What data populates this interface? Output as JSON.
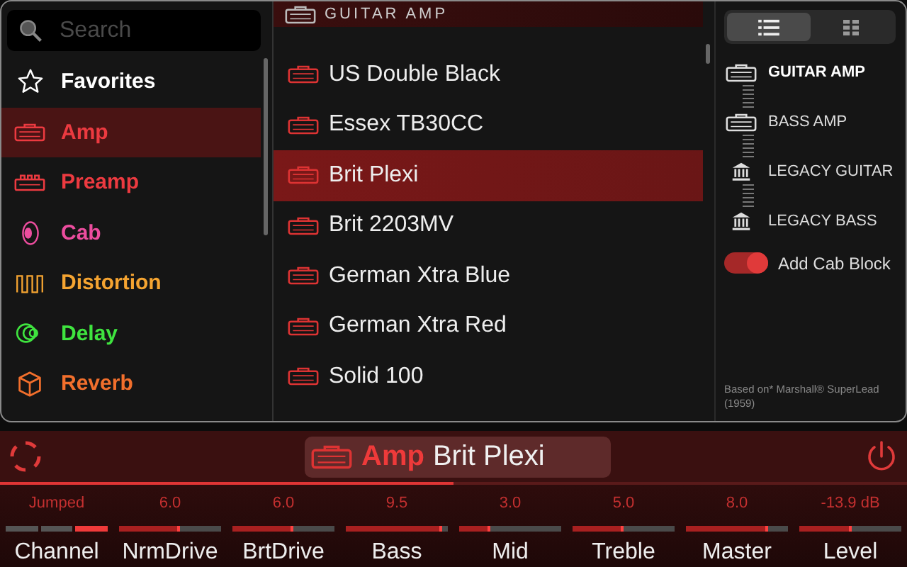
{
  "search": {
    "placeholder": "Search"
  },
  "categories": [
    {
      "label": "Favorites",
      "kind": "favorites",
      "color": "#ffffff",
      "selected": false
    },
    {
      "label": "Amp",
      "kind": "amp",
      "color": "#ec3a40",
      "selected": true
    },
    {
      "label": "Preamp",
      "kind": "preamp",
      "color": "#ec3a40",
      "selected": false
    },
    {
      "label": "Cab",
      "kind": "cab",
      "color": "#ec4d9e",
      "selected": false
    },
    {
      "label": "Distortion",
      "kind": "distortion",
      "color": "#f5a431",
      "selected": false
    },
    {
      "label": "Delay",
      "kind": "delay",
      "color": "#3fe43f",
      "selected": false
    },
    {
      "label": "Reverb",
      "kind": "reverb",
      "color": "#f26f2c",
      "selected": false
    }
  ],
  "model_list": {
    "header": "GUITAR AMP",
    "items": [
      {
        "label": "US Double Black",
        "selected": false
      },
      {
        "label": "Essex TB30CC",
        "selected": false
      },
      {
        "label": "Brit Plexi",
        "selected": true
      },
      {
        "label": "Brit 2203MV",
        "selected": false
      },
      {
        "label": "German Xtra Blue",
        "selected": false
      },
      {
        "label": "German Xtra Red",
        "selected": false
      },
      {
        "label": "Solid 100",
        "selected": false
      }
    ]
  },
  "view_toggle": [
    {
      "kind": "list",
      "selected": true
    },
    {
      "kind": "grid",
      "selected": false
    }
  ],
  "amp_types": [
    {
      "label": "GUITAR AMP",
      "kind": "amp",
      "selected": true
    },
    {
      "label": "BASS AMP",
      "kind": "amp",
      "selected": false
    },
    {
      "label": "LEGACY GUITAR",
      "kind": "legacy",
      "selected": false
    },
    {
      "label": "LEGACY BASS",
      "kind": "legacy",
      "selected": false
    }
  ],
  "cab_toggle": {
    "label": "Add Cab Block",
    "on": true
  },
  "model_note": "Based on* Marshall® SuperLead (1959)",
  "block": {
    "category": "Amp",
    "model": "Brit Plexi",
    "enabled": true
  },
  "params": [
    {
      "name": "Channel",
      "reading": "Jumped",
      "kind": "selector",
      "segments": [
        {
          "selected": false
        },
        {
          "selected": false
        },
        {
          "selected": true
        }
      ]
    },
    {
      "name": "NrmDrive",
      "reading": "6.0",
      "kind": "slider",
      "level": 0.6
    },
    {
      "name": "BrtDrive",
      "reading": "6.0",
      "kind": "slider",
      "level": 0.6
    },
    {
      "name": "Bass",
      "reading": "9.5",
      "kind": "slider",
      "level": 0.95
    },
    {
      "name": "Mid",
      "reading": "3.0",
      "kind": "slider",
      "level": 0.3
    },
    {
      "name": "Treble",
      "reading": "5.0",
      "kind": "slider",
      "level": 0.5
    },
    {
      "name": "Master",
      "reading": "8.0",
      "kind": "slider",
      "level": 0.8
    },
    {
      "name": "Level",
      "reading": "-13.9 dB",
      "kind": "slider",
      "level": 0.52
    }
  ]
}
